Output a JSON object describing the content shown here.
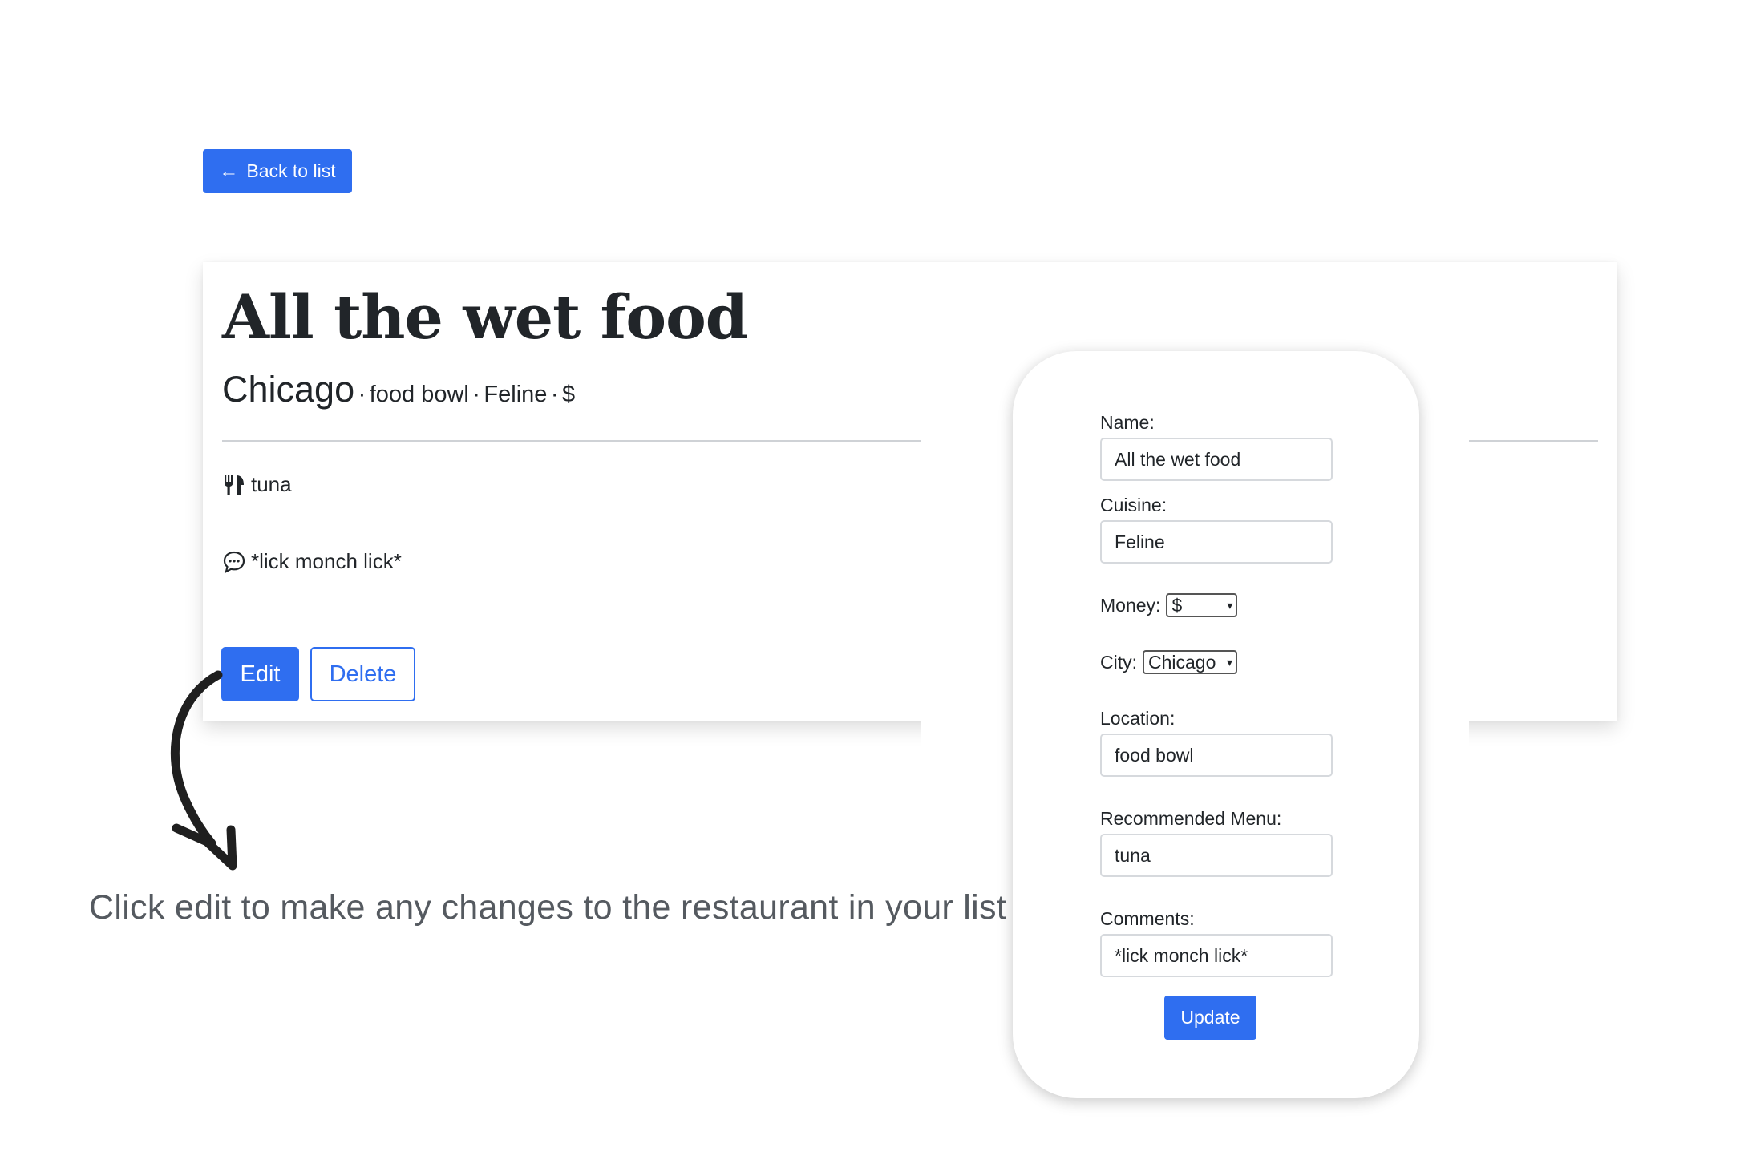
{
  "back_button": {
    "label": "Back to list",
    "icon": "left-arrow-icon"
  },
  "restaurant": {
    "name": "All the wet food",
    "city": "Chicago",
    "location": "food bowl",
    "cuisine": "Feline",
    "money": "$",
    "menu": "tuna",
    "comments": "*lick monch lick*",
    "separator": "·"
  },
  "actions": {
    "edit_label": "Edit",
    "delete_label": "Delete"
  },
  "form": {
    "name_label": "Name:",
    "name_value": "All the wet food",
    "cuisine_label": "Cuisine:",
    "cuisine_value": "Feline",
    "money_label": "Money:",
    "money_value": "$",
    "city_label": "City:",
    "city_value": "Chicago",
    "location_label": "Location:",
    "location_value": "food bowl",
    "menu_label": "Recommended Menu:",
    "menu_value": "tuna",
    "comments_label": "Comments:",
    "comments_value": "*lick monch lick*",
    "update_label": "Update"
  },
  "annotation": {
    "text": "Click edit to make any changes to the restaurant in your list"
  },
  "colors": {
    "primary": "#2f6ef0",
    "text": "#212529",
    "annotation_text": "#555a60"
  }
}
